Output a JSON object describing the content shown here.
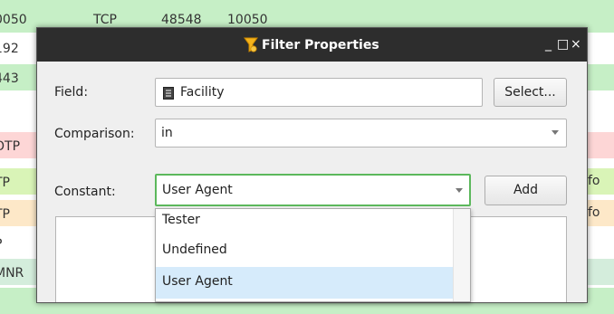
{
  "background_rows": [
    {
      "col1": "0050",
      "col2": "TCP",
      "col3": "48548",
      "col4": "10050",
      "color": "#c6efc6",
      "info": ""
    },
    {
      "col1": "192",
      "col2": "",
      "col3": "",
      "col4": "",
      "color": "#ffffff",
      "info": ""
    },
    {
      "col1": "443",
      "col2": "",
      "col3": "",
      "col4": "",
      "color": "#c6efc6",
      "info": ""
    },
    {
      "col1": "",
      "col2": "",
      "col3": "",
      "col4": "",
      "color": "#ffffff",
      "info": ""
    },
    {
      "col1": "OTP",
      "col2": "",
      "col3": "",
      "col4": "",
      "color": "#fdd6d6",
      "info": ""
    },
    {
      "col1": "TP",
      "col2": "",
      "col3": "",
      "col4": "",
      "color": "#d9f4b7",
      "info": "Info"
    },
    {
      "col1": "TP",
      "col2": "",
      "col3": "",
      "col4": "",
      "color": "#fde8c8",
      "info": "Info"
    },
    {
      "col1": "P",
      "col2": "",
      "col3": "",
      "col4": "",
      "color": "#ffffff",
      "info": ""
    },
    {
      "col1": "MNR",
      "col2": "",
      "col3": "",
      "col4": "",
      "color": "#d4eddc",
      "info": ""
    },
    {
      "col1": "",
      "col2": "",
      "col3": "",
      "col4": "",
      "color": "#c6efc6",
      "info": ""
    }
  ],
  "dialog": {
    "title": "Filter Properties",
    "controls": {
      "minimize": "_",
      "maximize": "□",
      "close": "×"
    },
    "field": {
      "label": "Field:",
      "value": "Facility",
      "select_button": "Select..."
    },
    "comparison": {
      "label": "Comparison:",
      "value": "in"
    },
    "constant": {
      "label": "Constant:",
      "value": "User Agent",
      "add_button": "Add"
    },
    "dropdown_options": [
      "Tester",
      "Undefined",
      "User Agent"
    ],
    "selected_option": "User Agent"
  },
  "colors": {
    "titlebar": "#2d2d2d",
    "focus_border": "#5cb85c",
    "selection": "#d6ebfb"
  }
}
